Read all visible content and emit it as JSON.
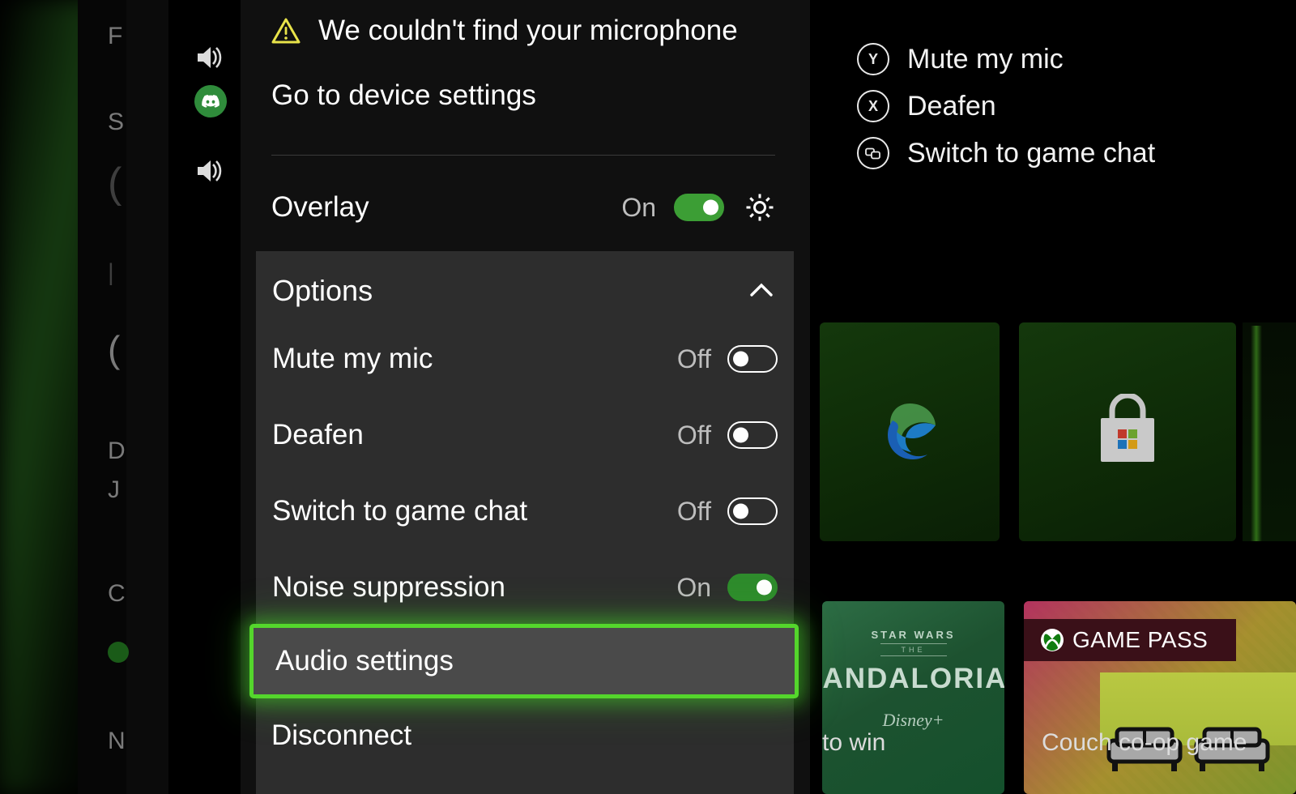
{
  "background": {
    "ghost_fragments": [
      "F",
      "S",
      "(",
      "|",
      "(",
      "D",
      "J",
      "C",
      "",
      "N"
    ],
    "rail_icons": [
      "speaker-icon",
      "discord-icon",
      "speaker-icon"
    ],
    "discord_badge_color": "#2f8c3b",
    "tiles": [
      {
        "name": "edge-app-tile",
        "icon": "microsoft-edge-icon",
        "caption": ""
      },
      {
        "name": "store-app-tile",
        "icon": "microsoft-store-icon",
        "caption": ""
      },
      {
        "name": "mandalorian-tile",
        "brand_top": "STAR WARS",
        "brand_the": "THE",
        "brand_main": "MANDALORIAN",
        "brand_service": "Disney+",
        "caption": "to win"
      },
      {
        "name": "game-pass-tile",
        "badge": "GAME PASS",
        "icon": "xbox-icon",
        "caption": "Couch co-op game"
      }
    ]
  },
  "hints": {
    "items": [
      {
        "button": "Y",
        "glyph": "Y",
        "icon": "y-button-icon",
        "label": "Mute my mic"
      },
      {
        "button": "X",
        "glyph": "X",
        "icon": "x-button-icon",
        "label": "Deafen"
      },
      {
        "button": "View",
        "glyph": "",
        "icon": "view-button-icon",
        "label": "Switch to game chat"
      }
    ]
  },
  "panel": {
    "alert": {
      "icon": "warning-icon",
      "text": "We couldn't find your microphone",
      "color": "#e8e34a"
    },
    "device_settings_link": "Go to device settings",
    "overlay": {
      "label": "Overlay",
      "state": "On",
      "toggle_on": true,
      "settings_icon": "gear-icon"
    }
  },
  "options": {
    "title": "Options",
    "collapse_icon": "chevron-up-icon",
    "rows": [
      {
        "label": "Mute my mic",
        "state": "Off",
        "on": false
      },
      {
        "label": "Deafen",
        "state": "Off",
        "on": false
      },
      {
        "label": "Switch to game chat",
        "state": "Off",
        "on": false
      },
      {
        "label": "Noise suppression",
        "state": "On",
        "on": true
      }
    ],
    "focused_item": {
      "label": "Audio settings",
      "focus_color": "#54d62c"
    },
    "disconnect": {
      "label": "Disconnect"
    }
  },
  "colors": {
    "panel_bg": "#101010",
    "options_bg": "#2d2d2d",
    "toggle_on": "#2e8b2c",
    "toggle_on_bright": "#3c9e35",
    "focus_green": "#54d62c",
    "warning_yellow": "#e8e34a",
    "text_primary": "#ffffff",
    "text_secondary": "#bdbdbd"
  }
}
